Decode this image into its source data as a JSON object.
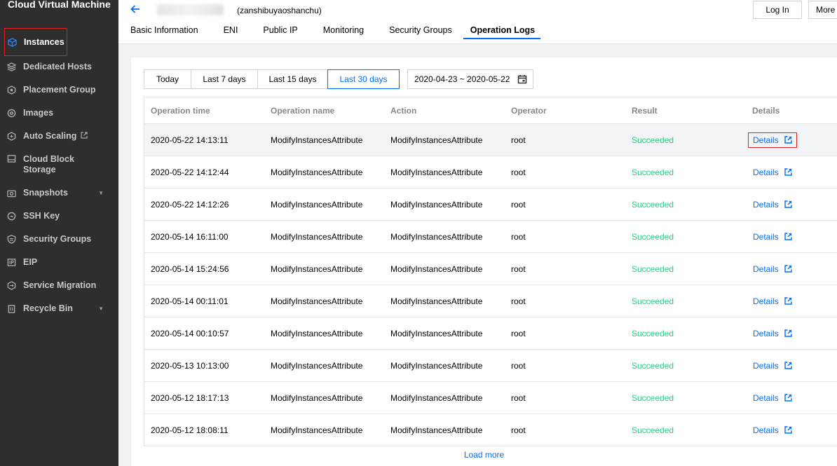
{
  "sidebar": {
    "title": "Cloud Virtual Machine",
    "items": [
      {
        "label": "Instances",
        "icon": "cube-icon"
      },
      {
        "label": "Dedicated Hosts",
        "icon": "layers-icon"
      },
      {
        "label": "Placement Group",
        "icon": "hexagon-icon"
      },
      {
        "label": "Images",
        "icon": "disc-icon"
      },
      {
        "label": "Auto Scaling",
        "icon": "scaling-icon"
      },
      {
        "label": "Cloud Block Storage",
        "icon": "storage-icon"
      },
      {
        "label": "Snapshots",
        "icon": "camera-icon"
      },
      {
        "label": "SSH Key",
        "icon": "key-icon"
      },
      {
        "label": "Security Groups",
        "icon": "shield-icon"
      },
      {
        "label": "EIP",
        "icon": "ip-icon"
      },
      {
        "label": "Service Migration",
        "icon": "migration-icon"
      },
      {
        "label": "Recycle Bin",
        "icon": "trash-icon"
      }
    ]
  },
  "header": {
    "instance_name": "(zanshibuyaoshanchu)",
    "login_label": "Log In",
    "more_label": "More",
    "tabs": [
      "Basic Information",
      "ENI",
      "Public IP",
      "Monitoring",
      "Security Groups",
      "Operation Logs"
    ]
  },
  "filters": {
    "ranges": [
      "Today",
      "Last 7 days",
      "Last 15 days",
      "Last 30 days"
    ],
    "date_range": "2020-04-23 ~ 2020-05-22"
  },
  "table": {
    "columns": [
      "Operation time",
      "Operation name",
      "Action",
      "Operator",
      "Result",
      "Details"
    ],
    "rows": [
      {
        "time": "2020-05-22 14:13:11",
        "name": "ModifyInstancesAttribute",
        "action": "ModifyInstancesAttribute",
        "operator": "root",
        "result": "Succeeded",
        "details": "Details"
      },
      {
        "time": "2020-05-22 14:12:44",
        "name": "ModifyInstancesAttribute",
        "action": "ModifyInstancesAttribute",
        "operator": "root",
        "result": "Succeeded",
        "details": "Details"
      },
      {
        "time": "2020-05-22 14:12:26",
        "name": "ModifyInstancesAttribute",
        "action": "ModifyInstancesAttribute",
        "operator": "root",
        "result": "Succeeded",
        "details": "Details"
      },
      {
        "time": "2020-05-14 16:11:00",
        "name": "ModifyInstancesAttribute",
        "action": "ModifyInstancesAttribute",
        "operator": "root",
        "result": "Succeeded",
        "details": "Details"
      },
      {
        "time": "2020-05-14 15:24:56",
        "name": "ModifyInstancesAttribute",
        "action": "ModifyInstancesAttribute",
        "operator": "root",
        "result": "Succeeded",
        "details": "Details"
      },
      {
        "time": "2020-05-14 00:11:01",
        "name": "ModifyInstancesAttribute",
        "action": "ModifyInstancesAttribute",
        "operator": "root",
        "result": "Succeeded",
        "details": "Details"
      },
      {
        "time": "2020-05-14 00:10:57",
        "name": "ModifyInstancesAttribute",
        "action": "ModifyInstancesAttribute",
        "operator": "root",
        "result": "Succeeded",
        "details": "Details"
      },
      {
        "time": "2020-05-13 10:13:00",
        "name": "ModifyInstancesAttribute",
        "action": "ModifyInstancesAttribute",
        "operator": "root",
        "result": "Succeeded",
        "details": "Details"
      },
      {
        "time": "2020-05-12 18:17:13",
        "name": "ModifyInstancesAttribute",
        "action": "ModifyInstancesAttribute",
        "operator": "root",
        "result": "Succeeded",
        "details": "Details"
      },
      {
        "time": "2020-05-12 18:08:11",
        "name": "ModifyInstancesAttribute",
        "action": "ModifyInstancesAttribute",
        "operator": "root",
        "result": "Succeeded",
        "details": "Details"
      }
    ]
  },
  "load_more": "Load more",
  "colors": {
    "accent": "#006eff",
    "success": "#29cc85",
    "sidebar_bg": "#2e2e2e",
    "highlight": "#e02020"
  }
}
